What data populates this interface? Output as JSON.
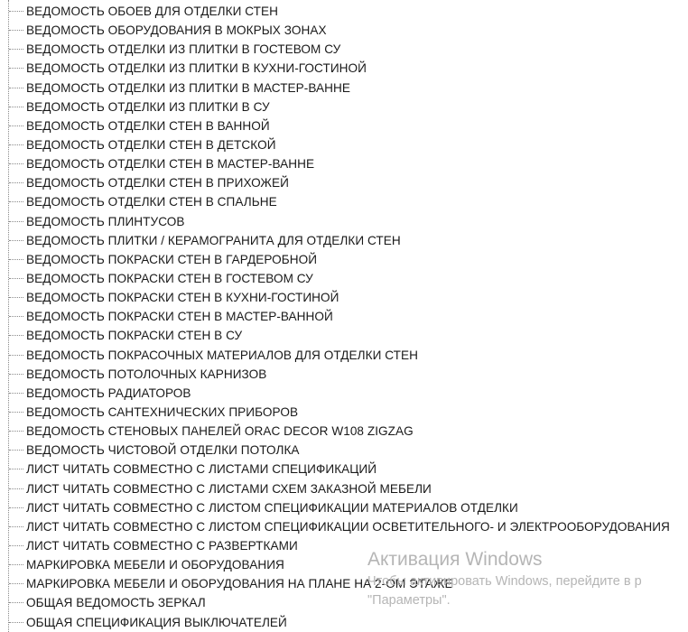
{
  "tree": {
    "items": [
      "ВЕДОМОСТЬ ОБОЕВ ДЛЯ ОТДЕЛКИ СТЕН",
      "ВЕДОМОСТЬ ОБОРУДОВАНИЯ В МОКРЫХ ЗОНАХ",
      "ВЕДОМОСТЬ ОТДЕЛКИ ИЗ ПЛИТКИ В ГОСТЕВОМ СУ",
      "ВЕДОМОСТЬ ОТДЕЛКИ ИЗ ПЛИТКИ В КУХНИ-ГОСТИНОЙ",
      "ВЕДОМОСТЬ ОТДЕЛКИ ИЗ ПЛИТКИ В МАСТЕР-ВАННЕ",
      "ВЕДОМОСТЬ ОТДЕЛКИ ИЗ ПЛИТКИ В СУ",
      "ВЕДОМОСТЬ ОТДЕЛКИ СТЕН В ВАННОЙ",
      "ВЕДОМОСТЬ ОТДЕЛКИ СТЕН В ДЕТСКОЙ",
      "ВЕДОМОСТЬ ОТДЕЛКИ СТЕН В МАСТЕР-ВАННЕ",
      "ВЕДОМОСТЬ ОТДЕЛКИ СТЕН В ПРИХОЖЕЙ",
      "ВЕДОМОСТЬ ОТДЕЛКИ СТЕН В СПАЛЬНЕ",
      "ВЕДОМОСТЬ ПЛИНТУСОВ",
      "ВЕДОМОСТЬ ПЛИТКИ / КЕРАМОГРАНИТА ДЛЯ ОТДЕЛКИ СТЕН",
      "ВЕДОМОСТЬ ПОКРАСКИ СТЕН В ГАРДЕРОБНОЙ",
      "ВЕДОМОСТЬ ПОКРАСКИ СТЕН В ГОСТЕВОМ СУ",
      "ВЕДОМОСТЬ ПОКРАСКИ СТЕН В КУХНИ-ГОСТИНОЙ",
      "ВЕДОМОСТЬ ПОКРАСКИ СТЕН В МАСТЕР-ВАННОЙ",
      "ВЕДОМОСТЬ ПОКРАСКИ СТЕН В СУ",
      "ВЕДОМОСТЬ ПОКРАСОЧНЫХ МАТЕРИАЛОВ ДЛЯ ОТДЕЛКИ СТЕН",
      "ВЕДОМОСТЬ ПОТОЛОЧНЫХ КАРНИЗОВ",
      "ВЕДОМОСТЬ РАДИАТОРОВ",
      "ВЕДОМОСТЬ САНТЕХНИЧЕСКИХ ПРИБОРОВ",
      "ВЕДОМОСТЬ СТЕНОВЫХ ПАНЕЛЕЙ ORAC DECOR W108 ZIGZAG",
      "ВЕДОМОСТЬ ЧИСТОВОЙ ОТДЕЛКИ ПОТОЛКА",
      "ЛИСТ ЧИТАТЬ СОВМЕСТНО С ЛИСТАМИ СПЕЦИФИКАЦИЙ",
      "ЛИСТ ЧИТАТЬ СОВМЕСТНО С ЛИСТАМИ СХЕМ ЗАКАЗНОЙ МЕБЕЛИ",
      "ЛИСТ ЧИТАТЬ СОВМЕСТНО С ЛИСТОМ СПЕЦИФИКАЦИИ МАТЕРИАЛОВ ОТДЕЛКИ",
      "ЛИСТ ЧИТАТЬ СОВМЕСТНО С ЛИСТОМ СПЕЦИФИКАЦИИ ОСВЕТИТЕЛЬНОГО- И ЭЛЕКТРООБОРУДОВАНИЯ",
      "ЛИСТ ЧИТАТЬ СОВМЕСТНО С РАЗВЕРТКАМИ",
      "МАРКИРОВКА МЕБЕЛИ И ОБОРУДОВАНИЯ",
      "МАРКИРОВКА МЕБЕЛИ И ОБОРУДОВАНИЯ НА ПЛАНЕ НА 2-ОМ ЭТАЖЕ",
      "ОБЩАЯ ВЕДОМОСТЬ ЗЕРКАЛ",
      "ОБЩАЯ СПЕЦИФИКАЦИЯ ВЫКЛЮЧАТЕЛЕЙ"
    ]
  },
  "watermark": {
    "title": "Активация Windows",
    "line1": "Чтобы активировать Windows, перейдите в р",
    "line2": "\"Параметры\"."
  },
  "colors": {
    "text": "#1a1a1a",
    "tree_lines": "#8a8a8a",
    "watermark": "#b5b5b5",
    "background": "#ffffff"
  }
}
